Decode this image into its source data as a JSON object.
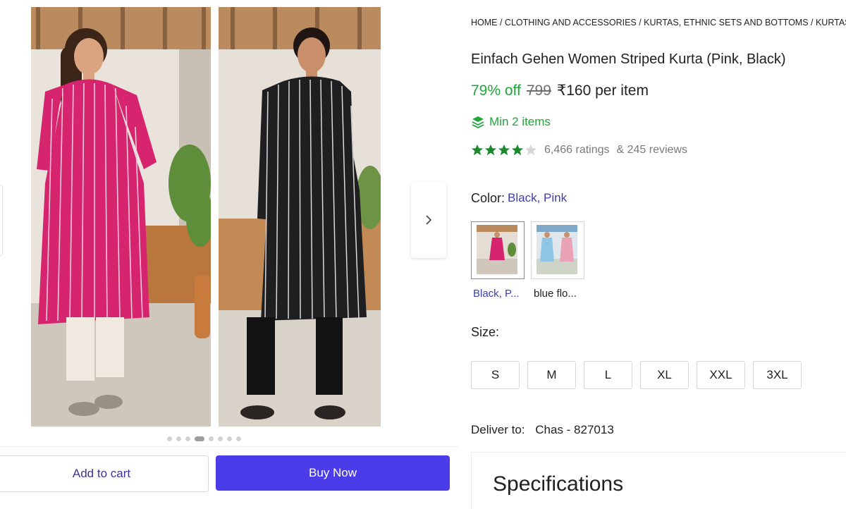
{
  "gallery": {
    "image_count": 8,
    "active_index": 3,
    "add_to_cart": "Add to cart",
    "buy_now": "Buy Now"
  },
  "product": {
    "breadcrumb": "HOME / CLOTHING AND ACCESSORIES / KURTAS, ETHNIC SETS AND BOTTOMS / KURTAS",
    "title": "Einfach Gehen Women Striped Kurta (Pink, Black)",
    "discount": "79% off",
    "mrp": "799",
    "price": "₹160 per item",
    "min_qty": "Min 2 items",
    "rating_stars": 4,
    "ratings": "6,466 ratings",
    "reviews": "& 245 reviews"
  },
  "color": {
    "label": "Color:",
    "selected_value": "Black, Pink",
    "swatches": [
      {
        "label": "Black, P...",
        "selected": true
      },
      {
        "label": "blue flo...",
        "selected": false
      }
    ]
  },
  "size": {
    "label": "Size:",
    "options": [
      "S",
      "M",
      "L",
      "XL",
      "XXL",
      "3XL"
    ]
  },
  "delivery": {
    "label": "Deliver to:",
    "location": "Chas - 827013"
  },
  "specifications": {
    "title": "Specifications"
  },
  "colors": {
    "accent": "#4a3ce8",
    "discount_green": "#1fa539",
    "link_blue": "#3b3fb0",
    "star_green": "#1b8a2f"
  }
}
